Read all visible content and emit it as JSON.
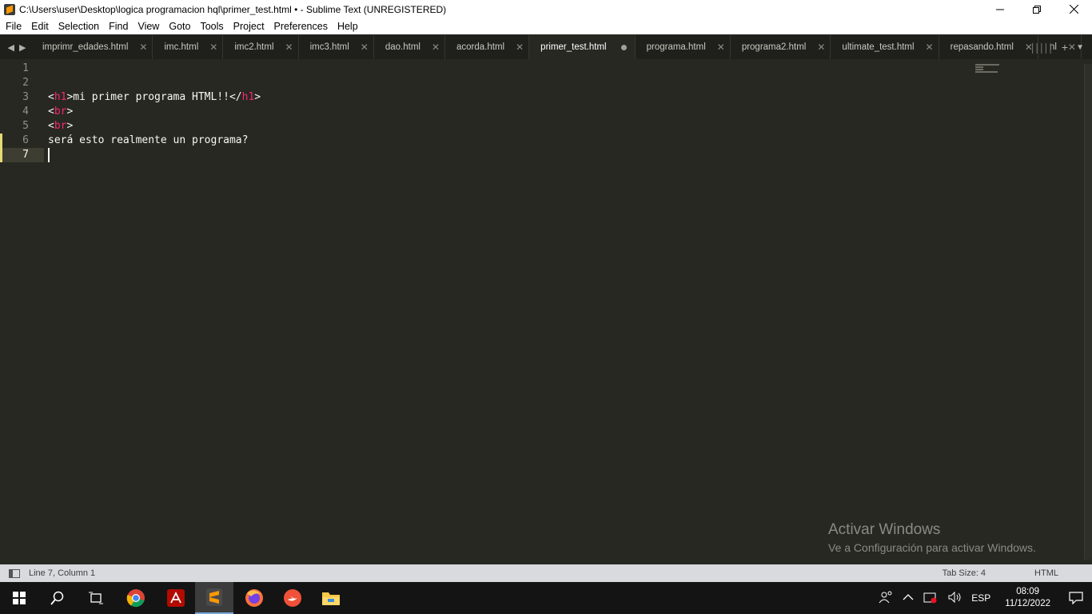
{
  "window": {
    "title": "C:\\Users\\user\\Desktop\\logica programacion hql\\primer_test.html • - Sublime Text (UNREGISTERED)",
    "app_icon": "sublime-icon"
  },
  "menu": [
    "File",
    "Edit",
    "Selection",
    "Find",
    "View",
    "Goto",
    "Tools",
    "Project",
    "Preferences",
    "Help"
  ],
  "tabs": [
    {
      "label": "imprimr_edades.html",
      "active": false
    },
    {
      "label": "imc.html",
      "active": false
    },
    {
      "label": "imc2.html",
      "active": false
    },
    {
      "label": "imc3.html",
      "active": false
    },
    {
      "label": "dao.html",
      "active": false
    },
    {
      "label": "acorda.html",
      "active": false
    },
    {
      "label": "primer_test.html",
      "active": true,
      "modified": true
    },
    {
      "label": "programa.html",
      "active": false
    },
    {
      "label": "programa2.html",
      "active": false
    },
    {
      "label": "ultimate_test.html",
      "active": false
    },
    {
      "label": "repasando.html",
      "active": false
    },
    {
      "label": "nl",
      "active": false
    }
  ],
  "editor": {
    "lines": [
      {
        "num": "1",
        "parts": []
      },
      {
        "num": "2",
        "parts": []
      },
      {
        "num": "3",
        "parts": [
          {
            "t": "<"
          },
          {
            "t": "h1",
            "tag": true
          },
          {
            "t": ">mi primer programa HTML!!</"
          },
          {
            "t": "h1",
            "tag": true
          },
          {
            "t": ">"
          }
        ]
      },
      {
        "num": "4",
        "parts": [
          {
            "t": "<"
          },
          {
            "t": "br",
            "tag": true
          },
          {
            "t": ">"
          }
        ]
      },
      {
        "num": "5",
        "parts": [
          {
            "t": "<"
          },
          {
            "t": "br",
            "tag": true
          },
          {
            "t": ">"
          }
        ]
      },
      {
        "num": "6",
        "parts": [
          {
            "t": "será esto realmente un programa?"
          }
        ],
        "modified": true
      },
      {
        "num": "7",
        "parts": [],
        "modified": true,
        "current": true
      }
    ]
  },
  "watermark": {
    "title": "Activar Windows",
    "subtitle": "Ve a Configuración para activar Windows."
  },
  "status": {
    "position": "Line 7, Column 1",
    "tab_size": "Tab Size: 4",
    "syntax": "HTML"
  },
  "taskbar": {
    "apps": [
      "start-icon",
      "search-icon",
      "task-view-icon",
      "chrome-icon",
      "acrobat-icon",
      "sublime-icon",
      "firefox-icon",
      "swift-icon",
      "file-explorer-icon"
    ],
    "active_app": "sublime-icon",
    "language": "ESP",
    "time": "08:09",
    "date": "11/12/2022"
  },
  "colors": {
    "editor_bg": "#272822",
    "tag": "#f92672",
    "text": "#f8f8f2",
    "modified_marker": "#e6db74"
  }
}
